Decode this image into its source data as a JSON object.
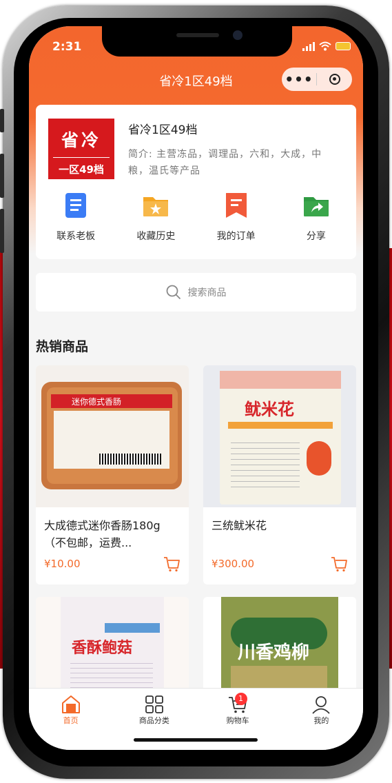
{
  "status_bar": {
    "time": "2:31"
  },
  "nav": {
    "title": "省冷1区49档",
    "more_label": "•••"
  },
  "shop": {
    "logo_line1": "省冷",
    "logo_line2": "一区49档",
    "name": "省冷1区49档",
    "intro": "简介: 主营冻品，调理品，六和，大成，中粮，温氏等产品"
  },
  "actions": [
    {
      "label": "联系老板",
      "icon": "document-icon",
      "color": "#3b7cf5"
    },
    {
      "label": "收藏历史",
      "icon": "folder-star-icon",
      "color": "#f5a623"
    },
    {
      "label": "我的订单",
      "icon": "bookmark-list-icon",
      "color": "#f15a3a"
    },
    {
      "label": "分享",
      "icon": "share-icon",
      "color": "#3aa64b"
    }
  ],
  "search": {
    "placeholder": "搜索商品"
  },
  "section": {
    "title": "热销商品"
  },
  "products": [
    {
      "name": "大成德式迷你香肠180g（不包邮，运费...",
      "price": "¥10.00",
      "pkg_text": "迷你德式香肠"
    },
    {
      "name": "三统鱿米花",
      "price": "¥300.00",
      "pkg_text": "鱿米花"
    },
    {
      "name": "",
      "price": "",
      "pkg_text": "香酥鲍菇"
    },
    {
      "name": "",
      "price": "",
      "pkg_text": "川香鸡柳"
    }
  ],
  "tabbar": [
    {
      "label": "首页",
      "icon": "home-icon",
      "active": true
    },
    {
      "label": "商品分类",
      "icon": "grid-icon"
    },
    {
      "label": "购物车",
      "icon": "cart-icon",
      "badge": "1"
    },
    {
      "label": "我的",
      "icon": "user-icon"
    }
  ],
  "colors": {
    "accent": "#f36a2a",
    "logo_red": "#d6191d"
  }
}
